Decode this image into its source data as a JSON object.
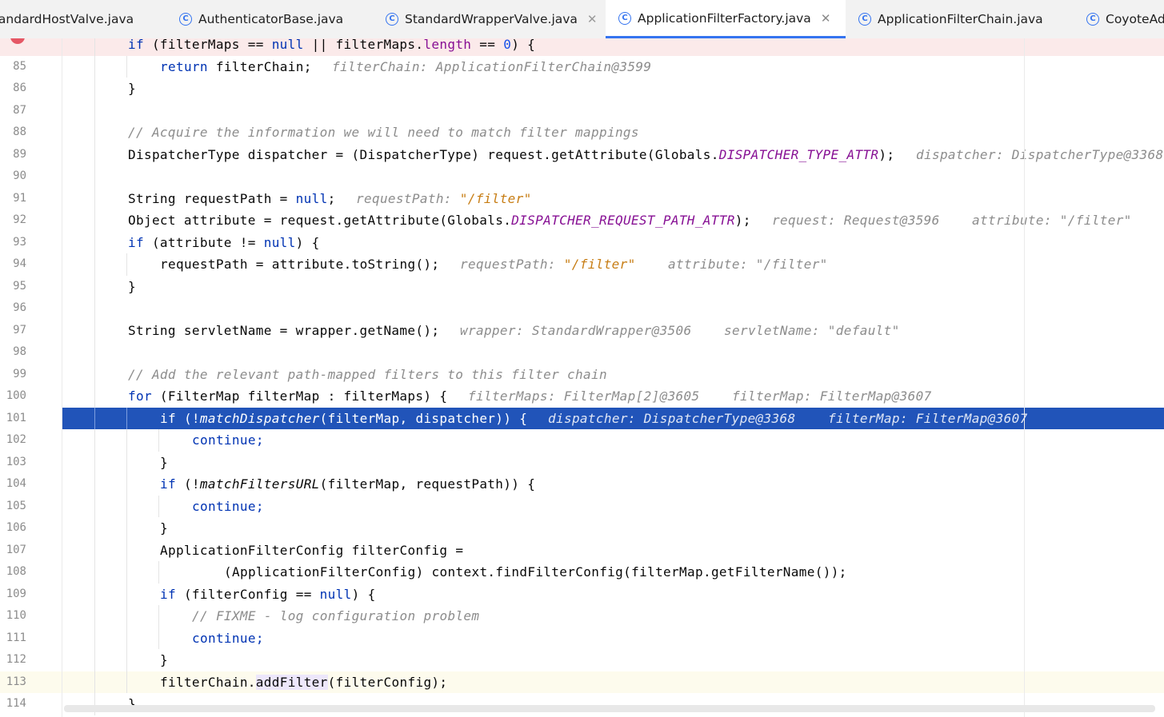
{
  "tabs": [
    {
      "label": "StandardHostValve.java",
      "active": false,
      "closable": false
    },
    {
      "label": "AuthenticatorBase.java",
      "active": false,
      "closable": false
    },
    {
      "label": "StandardWrapperValve.java",
      "active": false,
      "closable": true
    },
    {
      "label": "ApplicationFilterFactory.java",
      "active": true,
      "closable": true
    },
    {
      "label": "ApplicationFilterChain.java",
      "active": false,
      "closable": false
    },
    {
      "label": "CoyoteAdapter.java",
      "active": false,
      "closable": false
    }
  ],
  "icons": {
    "class_tab": "class-c-icon",
    "close": "close-icon",
    "breakpoint": "breakpoint-icon"
  },
  "colors": {
    "keyword": "#0033b3",
    "execution_line": "#2154b9",
    "breakpoint": "#e55765",
    "string_hint": "#c77d14",
    "static_field": "#871094"
  },
  "hints": {
    "h85": "filterChain: ApplicationFilterChain@3599",
    "h89": "dispatcher: DispatcherType@3368",
    "h91a": "requestPath: ",
    "h91b": "\"/filter\"",
    "h92a": "request: Request@3596",
    "h92b": "attribute: \"/filter\"",
    "h94a": "requestPath: ",
    "h94b": "\"/filter\"",
    "h94c": "attribute: \"/filter\"",
    "h97a": "wrapper: StandardWrapper@3506",
    "h97b": "servletName: \"default\"",
    "h100a": "filterMaps: FilterMap[2]@3605",
    "h100b": "filterMap: FilterMap@3607",
    "h101a": "dispatcher: DispatcherType@3368",
    "h101b": "filterMap: FilterMap@3607"
  },
  "code": {
    "l84": [
      "if",
      " (filterMaps == ",
      "null",
      " || filterMaps.",
      "length",
      " == ",
      "0",
      ") {"
    ],
    "l85": [
      "return",
      " filterChain;"
    ],
    "l86": "}",
    "l88": "// Acquire the information we will need to match filter mappings",
    "l89": [
      "DispatcherType dispatcher = (DispatcherType) request.getAttribute(Globals.",
      "DISPATCHER_TYPE_ATTR",
      ");"
    ],
    "l91": [
      "String requestPath = ",
      "null",
      ";"
    ],
    "l92": [
      "Object attribute = request.getAttribute(Globals.",
      "DISPATCHER_REQUEST_PATH_ATTR",
      ");"
    ],
    "l93": [
      "if",
      " (attribute != ",
      "null",
      ") {"
    ],
    "l94": "requestPath = attribute.toString();",
    "l95": "}",
    "l97": "String servletName = wrapper.getName();",
    "l99": "// Add the relevant path-mapped filters to this filter chain",
    "l100": [
      "for",
      " (FilterMap filterMap : filterMaps) {"
    ],
    "l101": [
      "if",
      " (!",
      "matchDispatcher",
      "(filterMap, dispatcher)) {"
    ],
    "l102": "continue;",
    "l103": "}",
    "l104": [
      "if",
      " (!",
      "matchFiltersURL",
      "(filterMap, requestPath)) {"
    ],
    "l105": "continue;",
    "l106": "}",
    "l107": "ApplicationFilterConfig filterConfig =",
    "l108": "(ApplicationFilterConfig) context.findFilterConfig(filterMap.getFilterName());",
    "l109": [
      "if",
      " (filterConfig == ",
      "null",
      ") {"
    ],
    "l110": "// FIXME - log configuration problem",
    "l111": "continue;",
    "l112": "}",
    "l113": [
      "filterChain.",
      "addFilter",
      "(filterConfig);"
    ],
    "l114": "}"
  },
  "line_numbers": [
    "85",
    "86",
    "87",
    "88",
    "89",
    "90",
    "91",
    "92",
    "93",
    "94",
    "95",
    "96",
    "97",
    "98",
    "99",
    "100",
    "101",
    "102",
    "103",
    "104",
    "105",
    "106",
    "107",
    "108",
    "109",
    "110",
    "111",
    "112",
    "113",
    "114"
  ]
}
